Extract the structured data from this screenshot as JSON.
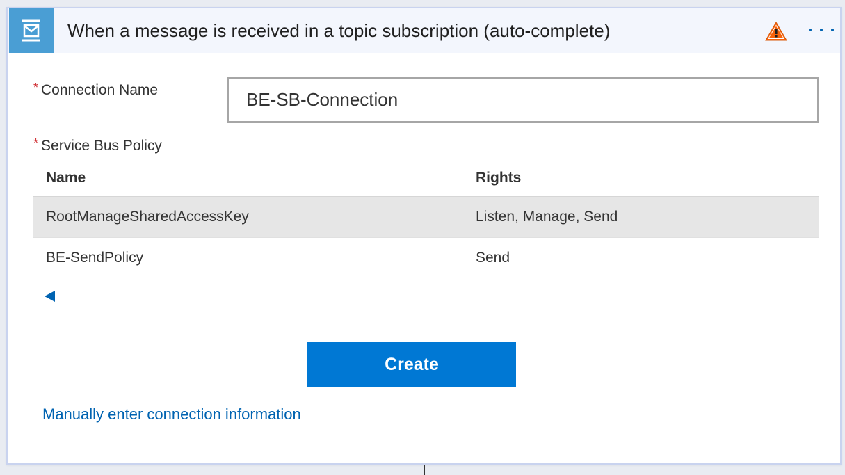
{
  "header": {
    "title": "When a message is received in a topic subscription (auto-complete)",
    "icon": "service-bus-envelope-icon",
    "warning_icon": "warning-triangle-icon",
    "more_icon": "ellipsis-icon",
    "colors": {
      "icon_background": "#4a9ed4",
      "header_background": "#f3f6fd",
      "warning": "#f7630c"
    }
  },
  "form": {
    "required_marker": "*",
    "connection_name": {
      "label": "Connection Name",
      "value": "BE-SB-Connection"
    },
    "policy": {
      "label": "Service Bus Policy",
      "columns": {
        "name": "Name",
        "rights": "Rights"
      },
      "rows": [
        {
          "name": "RootManageSharedAccessKey",
          "rights": "Listen, Manage, Send",
          "selected": true
        },
        {
          "name": "BE-SendPolicy",
          "rights": "Send",
          "selected": false
        }
      ]
    },
    "create_label": "Create",
    "manual_link": "Manually enter connection information"
  },
  "colors": {
    "accent": "#0078d4",
    "link": "#0063b1",
    "required": "#d13438",
    "selected_row": "#e6e6e6"
  }
}
